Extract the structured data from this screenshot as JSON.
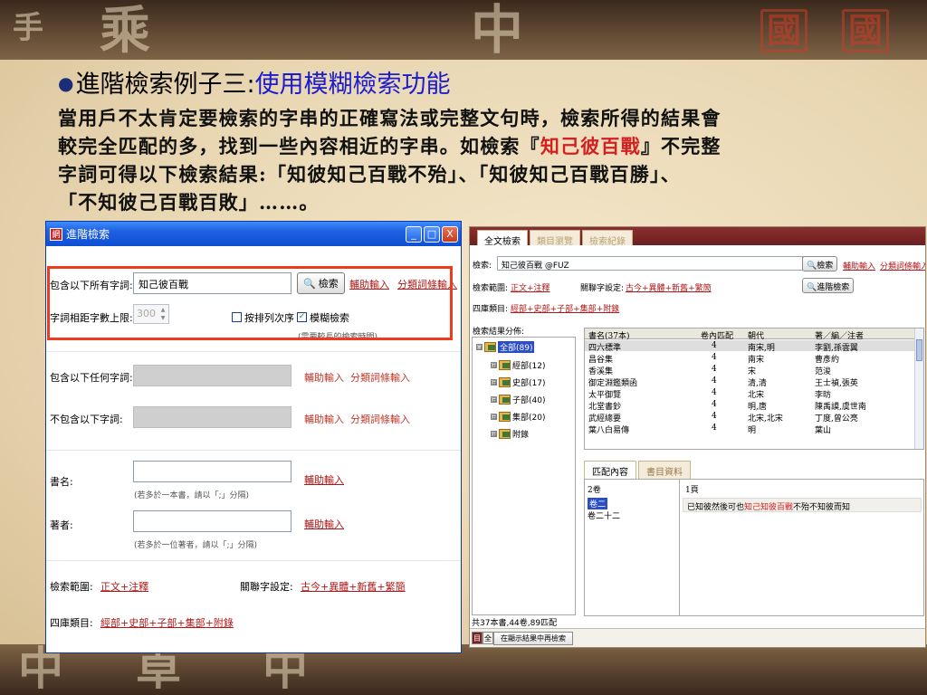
{
  "heading": {
    "bullet": "●",
    "prefix": "進階檢索例子三:",
    "highlight": "使用模糊檢索功能"
  },
  "paragraph": {
    "line1": "當用戶不太肯定要檢索的字串的正確寫法或完整文句時，檢索所得的結果會",
    "line2_a": "較完全匹配的多，找到一些內容相近的字串。如檢索『",
    "line2_red": "知己彼百戰",
    "line2_b": "』不完整",
    "line3": "字詞可得以下檢索結果:「知彼知己百戰不殆」、「知彼知己百戰百勝」、",
    "line4": "「不知彼己百戰百敗」……。"
  },
  "dialog": {
    "title": "進階檢索",
    "app_icon": "網",
    "win_buttons": {
      "minimize": "_",
      "maximize": "□",
      "close": "X"
    },
    "all_words_label": "包含以下所有字詞:",
    "all_words_value": "知己彼百戰",
    "search_btn": "檢索",
    "aux_input": "輔助輸入",
    "category_input": "分類詞條輸入",
    "distance_label": "字詞相距字數上限:",
    "distance_value": "300",
    "order_label": "按排列次序",
    "fuzzy_label": "模糊檢索",
    "fuzzy_check": "✓",
    "fuzzy_hint": "(需要較長的檢索時間)",
    "any_words_label": "包含以下任何字詞:",
    "exclude_label": "不包含以下字詞:",
    "book_label": "書名:",
    "book_hint": "(若多於一本書，請以「;」分隔)",
    "author_label": "著者:",
    "author_hint": "(若多於一位著者，請以「;」分隔)",
    "scope_label": "檢索範圍:",
    "scope_value": "正文+注釋",
    "related_label": "關聯字設定:",
    "related_value": "古今+異體+新舊+繁簡",
    "category_label": "四庫類目:",
    "category_value": "經部+史部+子部+集部+附錄"
  },
  "app": {
    "tabs": [
      "全文檢索",
      "類目瀏覽",
      "檢索紀錄"
    ],
    "search_label": "檢索:",
    "search_value": "知己彼百戰 @FUZ",
    "dd_icon": "▼",
    "search_btn": "檢索",
    "aux_input": "輔助輸入",
    "category_input": "分類詞條輸入",
    "scope_label": "檢索範圍:",
    "scope_value": "正文+注釋",
    "related_label": "關聯字設定:",
    "related_value": "古今+異體+新舊+繁簡",
    "adv_btn": "進階檢索",
    "cat_label": "四庫類目:",
    "cat_value": "經部+史部+子部+集部+附錄",
    "dist_label": "檢索結果分佈:",
    "tree": [
      {
        "toggle": "⊟",
        "label": "全部(89)"
      },
      {
        "toggle": "⊞",
        "label": "經部(12)"
      },
      {
        "toggle": "⊞",
        "label": "史部(17)"
      },
      {
        "toggle": "⊞",
        "label": "子部(40)"
      },
      {
        "toggle": "⊞",
        "label": "集部(20)"
      },
      {
        "toggle": "⊞",
        "label": "附錄"
      }
    ],
    "grid_headers": [
      "書名(37本)",
      "卷內匹配",
      "朝代",
      "著／編／注者"
    ],
    "grid_rows": [
      [
        "四六標準",
        "4",
        "南宋,明",
        "李劉,孫雲翼"
      ],
      [
        "昌谷集",
        "4",
        "南宋",
        "曹彥約"
      ],
      [
        "香溪集",
        "4",
        "宋",
        "范浚"
      ],
      [
        "御定淵鑑類函",
        "4",
        "清,清",
        "王士禎,張英"
      ],
      [
        "太平御覽",
        "4",
        "北宋",
        "李昉"
      ],
      [
        "北堂書鈔",
        "4",
        "明,唐",
        "陳禹謨,虞世南"
      ],
      [
        "武經總要",
        "4",
        "北宋,北宋",
        "丁度,曾公亮"
      ],
      [
        "葉八白易傳",
        "4",
        "明",
        "葉山"
      ]
    ],
    "subtabs": [
      "匹配內容",
      "書目資料"
    ],
    "match_count_label": "2卷",
    "page_label": "1頁",
    "chapters": [
      "卷二",
      "卷二十二"
    ],
    "match_pre": "已知彼然後可也",
    "match_red": "知己知彼百戰",
    "match_post": "不殆不知彼而知",
    "status": "共37本書,44卷,89匹配",
    "mini_tab_1": "目",
    "mini_tab_2": "全",
    "bottom_btn": "在顯示結果中再檢索"
  },
  "deco": {
    "chars": [
      "手",
      "乘",
      "中",
      "國",
      "國",
      "中",
      "卓",
      "中"
    ]
  }
}
